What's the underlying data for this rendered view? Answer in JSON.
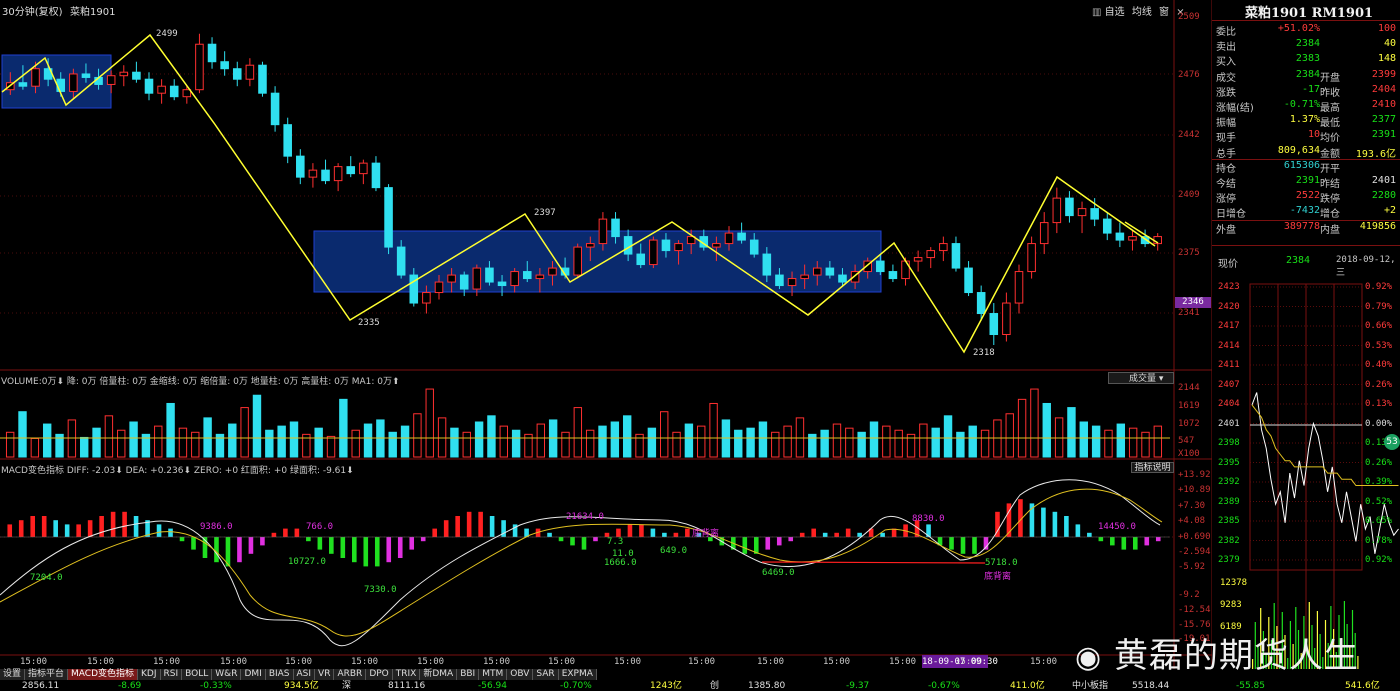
{
  "header": {
    "period_label": "30分钟(复权)",
    "symbol_short": "菜粕1901",
    "toolbar": [
      "自选",
      "均线",
      "窗"
    ]
  },
  "kline": {
    "price_labels": [
      "2509",
      "2476",
      "2442",
      "2409",
      "2375",
      "2341"
    ],
    "current_price_tag": "2346",
    "annotations": [
      "2499",
      "2397",
      "2335",
      "2318"
    ],
    "candles": [
      [
        2468,
        2478,
        2465,
        2472
      ],
      [
        2472,
        2482,
        2468,
        2470
      ],
      [
        2470,
        2484,
        2466,
        2480
      ],
      [
        2480,
        2486,
        2470,
        2474
      ],
      [
        2474,
        2478,
        2464,
        2467
      ],
      [
        2467,
        2480,
        2463,
        2477
      ],
      [
        2477,
        2483,
        2472,
        2475
      ],
      [
        2475,
        2480,
        2468,
        2471
      ],
      [
        2471,
        2479,
        2466,
        2476
      ],
      [
        2476,
        2482,
        2470,
        2478
      ],
      [
        2478,
        2484,
        2472,
        2474
      ],
      [
        2474,
        2478,
        2462,
        2466
      ],
      [
        2466,
        2474,
        2460,
        2470
      ],
      [
        2470,
        2474,
        2462,
        2464
      ],
      [
        2464,
        2470,
        2460,
        2468
      ],
      [
        2468,
        2500,
        2466,
        2494
      ],
      [
        2494,
        2498,
        2480,
        2484
      ],
      [
        2484,
        2490,
        2476,
        2480
      ],
      [
        2480,
        2484,
        2470,
        2474
      ],
      [
        2474,
        2486,
        2470,
        2482
      ],
      [
        2482,
        2484,
        2464,
        2466
      ],
      [
        2466,
        2470,
        2444,
        2448
      ],
      [
        2448,
        2452,
        2426,
        2430
      ],
      [
        2430,
        2434,
        2414,
        2418
      ],
      [
        2418,
        2426,
        2412,
        2422
      ],
      [
        2422,
        2428,
        2414,
        2416
      ],
      [
        2416,
        2426,
        2410,
        2424
      ],
      [
        2424,
        2430,
        2418,
        2420
      ],
      [
        2420,
        2428,
        2414,
        2426
      ],
      [
        2426,
        2430,
        2410,
        2412
      ],
      [
        2412,
        2414,
        2374,
        2378
      ],
      [
        2378,
        2382,
        2360,
        2362
      ],
      [
        2362,
        2366,
        2344,
        2346
      ],
      [
        2346,
        2356,
        2340,
        2352
      ],
      [
        2352,
        2362,
        2348,
        2358
      ],
      [
        2358,
        2366,
        2352,
        2362
      ],
      [
        2362,
        2364,
        2350,
        2354
      ],
      [
        2354,
        2368,
        2350,
        2366
      ],
      [
        2366,
        2370,
        2356,
        2358
      ],
      [
        2358,
        2362,
        2350,
        2356
      ],
      [
        2356,
        2366,
        2352,
        2364
      ],
      [
        2364,
        2370,
        2358,
        2360
      ],
      [
        2360,
        2366,
        2352,
        2362
      ],
      [
        2362,
        2370,
        2356,
        2366
      ],
      [
        2366,
        2372,
        2360,
        2362
      ],
      [
        2362,
        2380,
        2360,
        2378
      ],
      [
        2378,
        2384,
        2370,
        2380
      ],
      [
        2380,
        2398,
        2376,
        2394
      ],
      [
        2394,
        2398,
        2380,
        2384
      ],
      [
        2384,
        2388,
        2370,
        2374
      ],
      [
        2374,
        2380,
        2366,
        2368
      ],
      [
        2368,
        2384,
        2366,
        2382
      ],
      [
        2382,
        2386,
        2372,
        2376
      ],
      [
        2376,
        2382,
        2368,
        2380
      ],
      [
        2380,
        2388,
        2374,
        2384
      ],
      [
        2384,
        2388,
        2376,
        2378
      ],
      [
        2378,
        2384,
        2370,
        2380
      ],
      [
        2380,
        2390,
        2376,
        2386
      ],
      [
        2386,
        2392,
        2380,
        2382
      ],
      [
        2382,
        2386,
        2372,
        2374
      ],
      [
        2374,
        2378,
        2358,
        2362
      ],
      [
        2362,
        2366,
        2354,
        2356
      ],
      [
        2356,
        2364,
        2350,
        2360
      ],
      [
        2360,
        2368,
        2354,
        2362
      ],
      [
        2362,
        2370,
        2356,
        2366
      ],
      [
        2366,
        2370,
        2360,
        2362
      ],
      [
        2362,
        2366,
        2356,
        2358
      ],
      [
        2358,
        2368,
        2354,
        2364
      ],
      [
        2364,
        2372,
        2360,
        2370
      ],
      [
        2370,
        2374,
        2362,
        2364
      ],
      [
        2364,
        2368,
        2358,
        2360
      ],
      [
        2360,
        2372,
        2356,
        2370
      ],
      [
        2370,
        2376,
        2364,
        2372
      ],
      [
        2372,
        2378,
        2366,
        2376
      ],
      [
        2376,
        2384,
        2370,
        2380
      ],
      [
        2380,
        2384,
        2364,
        2366
      ],
      [
        2366,
        2370,
        2350,
        2352
      ],
      [
        2352,
        2356,
        2336,
        2340
      ],
      [
        2340,
        2346,
        2322,
        2328
      ],
      [
        2328,
        2352,
        2324,
        2346
      ],
      [
        2346,
        2368,
        2340,
        2364
      ],
      [
        2364,
        2384,
        2360,
        2380
      ],
      [
        2380,
        2398,
        2374,
        2392
      ],
      [
        2392,
        2412,
        2386,
        2406
      ],
      [
        2406,
        2410,
        2392,
        2396
      ],
      [
        2396,
        2404,
        2386,
        2400
      ],
      [
        2400,
        2406,
        2390,
        2394
      ],
      [
        2394,
        2398,
        2382,
        2386
      ],
      [
        2386,
        2392,
        2378,
        2382
      ],
      [
        2382,
        2388,
        2376,
        2384
      ],
      [
        2384,
        2388,
        2378,
        2380
      ],
      [
        2380,
        2386,
        2376,
        2384
      ]
    ]
  },
  "volume_panel": {
    "legend": "VOLUME:0万⬇ 降: 0万 倍量柱: 0万 金缩线: 0万 缩倍量: 0万 地量柱: 0万 高量柱: 0万 MA1: 0万⬆",
    "button": "成交量",
    "axis": [
      "2144",
      "1619",
      "1072",
      "547",
      "X100"
    ],
    "volumes": [
      120,
      220,
      90,
      160,
      110,
      180,
      95,
      140,
      200,
      130,
      170,
      110,
      150,
      260,
      140,
      120,
      190,
      110,
      160,
      240,
      300,
      130,
      150,
      170,
      110,
      140,
      100,
      280,
      130,
      160,
      180,
      120,
      150,
      210,
      330,
      190,
      140,
      120,
      170,
      200,
      150,
      130,
      110,
      160,
      180,
      120,
      240,
      130,
      150,
      170,
      200,
      110,
      140,
      220,
      120,
      160,
      150,
      260,
      180,
      130,
      140,
      170,
      120,
      150,
      190,
      110,
      130,
      160,
      140,
      120,
      170,
      150,
      130,
      110,
      160,
      140,
      200,
      120,
      150,
      130,
      180,
      210,
      280,
      330,
      260,
      190,
      240,
      170,
      150,
      130,
      160,
      140,
      120,
      150
    ]
  },
  "macd_panel": {
    "legend": "MACD变色指标 DIFF: -2.03⬇ DEA: +0.236⬇ ZERO: +0 红面积: +0 绿面积: -9.61⬇",
    "button": "指标说明",
    "axis": [
      "+13.92",
      "+10.89",
      "+7.30",
      "+4.08",
      "+0.690",
      "-2.594",
      "-5.92",
      "-9.2",
      "-12.54",
      "-15.76",
      "-19.01"
    ],
    "annotations": [
      "7204.0",
      "9386.0",
      "766.0",
      "10727.0",
      "7330.0",
      "21634.0",
      "7.3",
      "11.0",
      "1666.0",
      "649.0",
      "底背离",
      "6469.0",
      "8830.0",
      "5718.0",
      "底背离",
      "14450.0"
    ],
    "hist": [
      3,
      4,
      5,
      5,
      4,
      3,
      3,
      4,
      5,
      6,
      6,
      5,
      4,
      3,
      2,
      -1,
      -3,
      -5,
      -6,
      -7,
      -6,
      -4,
      -2,
      1,
      2,
      2,
      -1,
      -3,
      -4,
      -5,
      -6,
      -7,
      -7,
      -6,
      -5,
      -3,
      -1,
      2,
      4,
      5,
      6,
      6,
      5,
      4,
      3,
      2,
      2,
      1,
      -1,
      -2,
      -3,
      -1,
      1,
      2,
      3,
      3,
      2,
      1,
      1,
      2,
      1,
      -1,
      -2,
      -3,
      -4,
      -4,
      -3,
      -2,
      -1,
      1,
      2,
      1,
      1,
      2,
      1,
      2,
      1,
      2,
      3,
      4,
      3,
      -2,
      -3,
      -4,
      -4,
      -3,
      6,
      8,
      9,
      8,
      7,
      6,
      5,
      3,
      1,
      -1,
      -2,
      -3,
      -3,
      -2,
      -1
    ]
  },
  "quote_panel": {
    "title": "菜粕1901 RM1901",
    "rows": [
      {
        "l": "委比",
        "v1": "+51.02%",
        "c1": "#ff3b3b",
        "l2": "",
        "v2": "100",
        "c2": "#ff3b3b"
      },
      {
        "l": "卖出",
        "v1": "2384",
        "c1": "#18e018",
        "l2": "",
        "v2": "40",
        "c2": "#ffff40"
      },
      {
        "l": "买入",
        "v1": "2383",
        "c1": "#18e018",
        "l2": "",
        "v2": "148",
        "c2": "#ffff40"
      },
      {
        "l": "成交",
        "v1": "2384",
        "c1": "#18e018",
        "l2": "开盘",
        "v2": "2399",
        "c2": "#ff3b3b"
      },
      {
        "l": "涨跌",
        "v1": "-17",
        "c1": "#18e018",
        "l2": "昨收",
        "v2": "2404",
        "c2": "#ff3b3b"
      },
      {
        "l": "涨幅(结)",
        "v1": "-0.71%",
        "c1": "#18e018",
        "l2": "最高",
        "v2": "2410",
        "c2": "#ff3b3b"
      },
      {
        "l": "振幅",
        "v1": "1.37%",
        "c1": "#ffff40",
        "l2": "最低",
        "v2": "2377",
        "c2": "#18e018"
      },
      {
        "l": "现手",
        "v1": "10",
        "c1": "#ff3b3b",
        "l2": "均价",
        "v2": "2391",
        "c2": "#18e018"
      },
      {
        "l": "总手",
        "v1": "809,634",
        "c1": "#ffff40",
        "l2": "金额",
        "v2": "193.6亿",
        "c2": "#ffff40"
      },
      {
        "l": "持仓",
        "v1": "615306",
        "c1": "#30d0d0",
        "l2": "开平",
        "v2": "",
        "c2": "#ffff40"
      },
      {
        "l": "今结",
        "v1": "2391",
        "c1": "#18e018",
        "l2": "昨结",
        "v2": "2401",
        "c2": "#e0e0e0"
      },
      {
        "l": "涨停",
        "v1": "2522",
        "c1": "#ff3b3b",
        "l2": "跌停",
        "v2": "2280",
        "c2": "#18e018"
      },
      {
        "l": "日增仓",
        "v1": "-7432",
        "c1": "#30d0d0",
        "l2": "增仓",
        "v2": "+2",
        "c2": "#ffff40"
      },
      {
        "l": "外盘",
        "v1": "389778",
        "c1": "#ff3b3b",
        "l2": "内盘",
        "v2": "419856",
        "c2": "#ffff40"
      }
    ],
    "current_label": "现价",
    "current_value": "2384",
    "date": "2018-09-12,三"
  },
  "timeline": {
    "left_axis": [
      "2423",
      "2420",
      "2417",
      "2414",
      "2411",
      "2407",
      "2404",
      "2401",
      "2398",
      "2395",
      "2392",
      "2389",
      "2385",
      "2382",
      "2379"
    ],
    "right_axis": [
      "0.92%",
      "0.79%",
      "0.66%",
      "0.53%",
      "0.40%",
      "0.26%",
      "0.13%",
      "0.00%",
      "0.13%",
      "0.26%",
      "0.39%",
      "0.52%",
      "0.65%",
      "0.78%",
      "0.92%"
    ],
    "vol_axis": [
      "12378",
      "9283",
      "6189"
    ],
    "badge": "53",
    "prices": [
      2404,
      2406,
      2400,
      2397,
      2392,
      2388,
      2390,
      2385,
      2393,
      2389,
      2395,
      2391,
      2397,
      2401,
      2399,
      2395,
      2390,
      2394,
      2388,
      2385,
      2390,
      2386,
      2382,
      2388,
      2384,
      2386,
      2380,
      2384,
      2388,
      2385,
      2383,
      2384
    ],
    "avg": [
      2404,
      2403,
      2402,
      2400,
      2399,
      2397,
      2396,
      2395,
      2395,
      2394,
      2394,
      2394,
      2394,
      2394,
      2394,
      2394,
      2393,
      2393,
      2393,
      2392,
      2392,
      2392,
      2391,
      2391,
      2391,
      2391,
      2391,
      2391,
      2391,
      2391,
      2391,
      2391
    ]
  },
  "time_axis": [
    "15:00",
    "15:00",
    "15:00",
    "15:00",
    "15:00",
    "15:00",
    "15:00",
    "15:00",
    "15:00",
    "15:00",
    "15:00",
    "15:00",
    "15:00",
    "15:00",
    "15:00",
    "15:00",
    "18-09-07 09:30",
    "15:00"
  ],
  "tabs": [
    "设置",
    "指标平台",
    "MACD变色指标",
    "KDJ",
    "RSI",
    "BOLL",
    "W&R",
    "DMI",
    "BIAS",
    "ASI",
    "VR",
    "ARBR",
    "DPO",
    "TRIX",
    "新DMA",
    "BBI",
    "MTM",
    "OBV",
    "SAR",
    "EXPMA"
  ],
  "status_bar": [
    {
      "t": "2856.11",
      "c": "#e0e0e0"
    },
    {
      "t": "-8.69",
      "c": "#18e018"
    },
    {
      "t": "-0.33%",
      "c": "#18e018"
    },
    {
      "t": "934.5亿",
      "c": "#ffff40"
    },
    {
      "t": "深",
      "c": "#e0e0e0"
    },
    {
      "t": "8111.16",
      "c": "#e0e0e0"
    },
    {
      "t": "-56.94",
      "c": "#18e018"
    },
    {
      "t": "-0.70%",
      "c": "#18e018"
    },
    {
      "t": "1243亿",
      "c": "#ffff40"
    },
    {
      "t": "创",
      "c": "#e0e0e0"
    },
    {
      "t": "1385.80",
      "c": "#e0e0e0"
    },
    {
      "t": "-9.37",
      "c": "#18e018"
    },
    {
      "t": "-0.67%",
      "c": "#18e018"
    },
    {
      "t": "411.0亿",
      "c": "#ffff40"
    },
    {
      "t": "中小板指",
      "c": "#e0e0e0"
    },
    {
      "t": "5518.44",
      "c": "#e0e0e0"
    },
    {
      "t": "-55.85",
      "c": "#18e018"
    },
    {
      "t": "541.6亿",
      "c": "#ffff40"
    }
  ],
  "watermark": "黄磊的期货人生"
}
